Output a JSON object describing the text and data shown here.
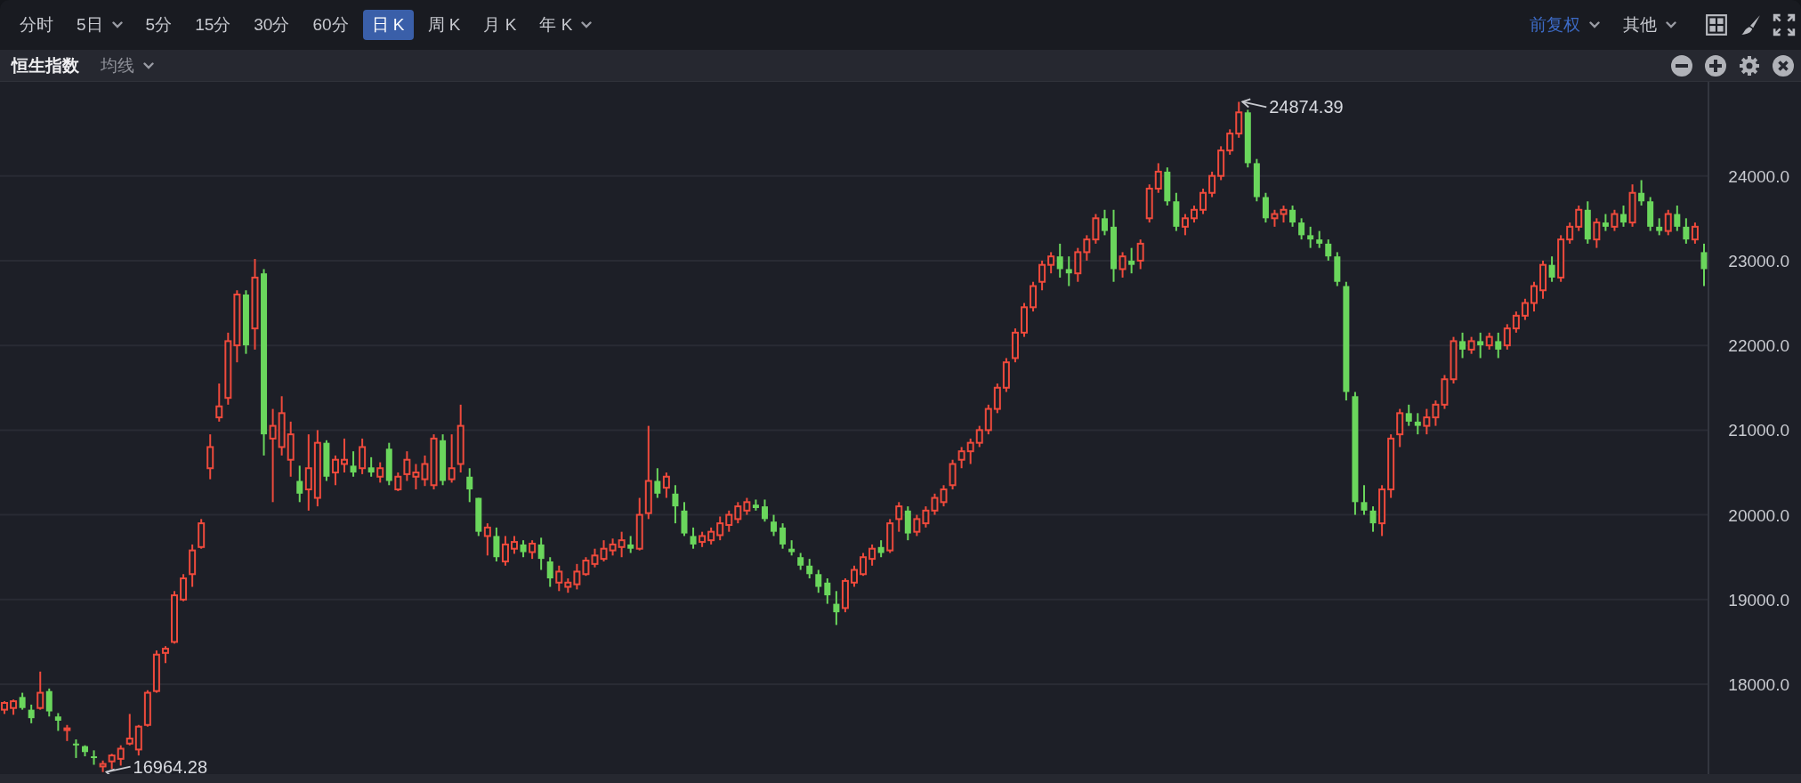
{
  "toolbar": {
    "periods": [
      {
        "label": "分时",
        "selected": false,
        "menu": false
      },
      {
        "label": "5日",
        "selected": false,
        "menu": true
      },
      {
        "label": "5分",
        "selected": false,
        "menu": false
      },
      {
        "label": "15分",
        "selected": false,
        "menu": false
      },
      {
        "label": "30分",
        "selected": false,
        "menu": false
      },
      {
        "label": "60分",
        "selected": false,
        "menu": false
      },
      {
        "label": "日 K",
        "selected": true,
        "menu": false
      },
      {
        "label": "周 K",
        "selected": false,
        "menu": false
      },
      {
        "label": "月 K",
        "selected": false,
        "menu": false
      },
      {
        "label": "年 K",
        "selected": false,
        "menu": true
      }
    ],
    "options": [
      {
        "label": "前复权",
        "selected": true,
        "menu": true
      },
      {
        "label": "其他",
        "selected": false,
        "menu": true
      }
    ]
  },
  "panel": {
    "title": "恒生指数",
    "indicator": {
      "label": "均线",
      "menu": true
    }
  },
  "chart": {
    "chart_data": {
      "type": "candlestick",
      "grid": true,
      "ylim": [
        16940,
        25110
      ],
      "yticks": [
        {
          "value": 24000,
          "label": "24000.0"
        },
        {
          "value": 23000,
          "label": "23000.0"
        },
        {
          "value": 22000,
          "label": "22000.0"
        },
        {
          "value": 21000,
          "label": "21000.0"
        },
        {
          "value": 20000,
          "label": "20000.0"
        },
        {
          "value": 19000,
          "label": "19000.0"
        },
        {
          "value": 18000,
          "label": "18000.0"
        }
      ],
      "ohlc": [
        [
          17700,
          17800,
          17650,
          17780
        ],
        [
          17720,
          17820,
          17640,
          17800
        ],
        [
          17850,
          17900,
          17700,
          17720
        ],
        [
          17700,
          17760,
          17540,
          17600
        ],
        [
          17720,
          18150,
          17700,
          17900
        ],
        [
          17920,
          17950,
          17620,
          17680
        ],
        [
          17620,
          17660,
          17450,
          17570
        ],
        [
          17470,
          17520,
          17330,
          17480
        ],
        [
          17300,
          17350,
          17130,
          17280
        ],
        [
          17270,
          17280,
          17150,
          17200
        ],
        [
          17150,
          17220,
          17050,
          17130
        ],
        [
          17030,
          17100,
          16964,
          17060
        ],
        [
          17090,
          17180,
          17000,
          17160
        ],
        [
          17120,
          17280,
          17040,
          17240
        ],
        [
          17300,
          17650,
          17280,
          17360
        ],
        [
          17230,
          17520,
          17160,
          17500
        ],
        [
          17520,
          17930,
          17500,
          17900
        ],
        [
          17920,
          18400,
          17900,
          18350
        ],
        [
          18370,
          18450,
          18250,
          18420
        ],
        [
          18500,
          19100,
          18480,
          19050
        ],
        [
          19000,
          19300,
          18980,
          19250
        ],
        [
          19300,
          19650,
          19150,
          19580
        ],
        [
          19620,
          19950,
          19600,
          19900
        ],
        [
          20550,
          20950,
          20420,
          20800
        ],
        [
          21150,
          21550,
          21100,
          21280
        ],
        [
          21380,
          22150,
          21300,
          22050
        ],
        [
          22000,
          22650,
          21800,
          22600
        ],
        [
          22600,
          22650,
          21900,
          22000
        ],
        [
          22200,
          23020,
          21950,
          22800
        ],
        [
          22850,
          22900,
          20700,
          20950
        ],
        [
          20900,
          21250,
          20150,
          21050
        ],
        [
          20800,
          21400,
          20700,
          21200
        ],
        [
          20650,
          21100,
          20450,
          20950
        ],
        [
          20400,
          20580,
          20150,
          20250
        ],
        [
          20300,
          20950,
          20050,
          20550
        ],
        [
          20200,
          21000,
          20100,
          20850
        ],
        [
          20850,
          20880,
          20400,
          20450
        ],
        [
          20500,
          20700,
          20350,
          20650
        ],
        [
          20600,
          20900,
          20500,
          20650
        ],
        [
          20580,
          20750,
          20450,
          20500
        ],
        [
          20550,
          20900,
          20480,
          20800
        ],
        [
          20560,
          20680,
          20450,
          20500
        ],
        [
          20450,
          20620,
          20380,
          20550
        ],
        [
          20780,
          20850,
          20350,
          20400
        ],
        [
          20300,
          20500,
          20280,
          20450
        ],
        [
          20480,
          20750,
          20400,
          20650
        ],
        [
          20450,
          20600,
          20300,
          20500
        ],
        [
          20420,
          20700,
          20340,
          20600
        ],
        [
          20350,
          20950,
          20300,
          20900
        ],
        [
          20880,
          20950,
          20350,
          20400
        ],
        [
          20420,
          20950,
          20380,
          20550
        ],
        [
          20600,
          21300,
          20500,
          21050
        ],
        [
          20450,
          20550,
          20150,
          20300
        ],
        [
          20200,
          20200,
          19750,
          19800
        ],
        [
          19750,
          19900,
          19520,
          19850
        ],
        [
          19750,
          19850,
          19450,
          19500
        ],
        [
          19450,
          19750,
          19400,
          19650
        ],
        [
          19600,
          19750,
          19540,
          19680
        ],
        [
          19650,
          19700,
          19500,
          19560
        ],
        [
          19560,
          19700,
          19480,
          19660
        ],
        [
          19650,
          19730,
          19350,
          19480
        ],
        [
          19450,
          19500,
          19150,
          19250
        ],
        [
          19200,
          19400,
          19100,
          19330
        ],
        [
          19150,
          19250,
          19080,
          19200
        ],
        [
          19180,
          19420,
          19120,
          19330
        ],
        [
          19300,
          19500,
          19280,
          19460
        ],
        [
          19420,
          19600,
          19380,
          19520
        ],
        [
          19480,
          19700,
          19450,
          19600
        ],
        [
          19580,
          19720,
          19520,
          19650
        ],
        [
          19620,
          19800,
          19500,
          19700
        ],
        [
          19650,
          19750,
          19550,
          19600
        ],
        [
          19600,
          20200,
          19580,
          20000
        ],
        [
          20020,
          21050,
          19950,
          20400
        ],
        [
          20400,
          20550,
          20200,
          20250
        ],
        [
          20320,
          20500,
          20200,
          20450
        ],
        [
          20250,
          20350,
          19900,
          20100
        ],
        [
          20050,
          20150,
          19750,
          19780
        ],
        [
          19750,
          19850,
          19600,
          19650
        ],
        [
          19680,
          19800,
          19620,
          19750
        ],
        [
          19700,
          19850,
          19650,
          19800
        ],
        [
          19760,
          19980,
          19700,
          19900
        ],
        [
          19880,
          20050,
          19800,
          20000
        ],
        [
          19950,
          20150,
          19900,
          20100
        ],
        [
          20050,
          20200,
          20000,
          20150
        ],
        [
          20120,
          20180,
          20050,
          20080
        ],
        [
          20100,
          20180,
          19920,
          19950
        ],
        [
          19920,
          20000,
          19750,
          19800
        ],
        [
          19850,
          19900,
          19600,
          19650
        ],
        [
          19600,
          19700,
          19520,
          19560
        ],
        [
          19500,
          19550,
          19350,
          19400
        ],
        [
          19400,
          19480,
          19250,
          19300
        ],
        [
          19300,
          19350,
          19080,
          19150
        ],
        [
          19200,
          19250,
          18950,
          19050
        ],
        [
          18950,
          19100,
          18700,
          18850
        ],
        [
          18900,
          19250,
          18850,
          19220
        ],
        [
          19200,
          19400,
          19150,
          19350
        ],
        [
          19300,
          19550,
          19280,
          19500
        ],
        [
          19480,
          19650,
          19400,
          19600
        ],
        [
          19620,
          19700,
          19500,
          19550
        ],
        [
          19580,
          19950,
          19550,
          19900
        ],
        [
          19950,
          20150,
          19800,
          20100
        ],
        [
          20050,
          20100,
          19700,
          19780
        ],
        [
          19800,
          20000,
          19750,
          19950
        ],
        [
          19900,
          20100,
          19850,
          20050
        ],
        [
          20050,
          20250,
          20000,
          20200
        ],
        [
          20150,
          20350,
          20100,
          20300
        ],
        [
          20350,
          20650,
          20300,
          20600
        ],
        [
          20650,
          20800,
          20550,
          20750
        ],
        [
          20750,
          20900,
          20600,
          20850
        ],
        [
          20850,
          21050,
          20800,
          21000
        ],
        [
          21000,
          21300,
          20950,
          21250
        ],
        [
          21250,
          21550,
          21200,
          21500
        ],
        [
          21500,
          21850,
          21450,
          21800
        ],
        [
          21850,
          22200,
          21800,
          22150
        ],
        [
          22150,
          22500,
          22100,
          22450
        ],
        [
          22450,
          22750,
          22400,
          22700
        ],
        [
          22750,
          23000,
          22650,
          22950
        ],
        [
          22950,
          23100,
          22850,
          23050
        ],
        [
          23050,
          23200,
          22800,
          22900
        ],
        [
          22900,
          23050,
          22700,
          22850
        ],
        [
          22850,
          23150,
          22750,
          23100
        ],
        [
          23100,
          23300,
          23000,
          23250
        ],
        [
          23250,
          23550,
          23200,
          23500
        ],
        [
          23500,
          23600,
          23300,
          23350
        ],
        [
          23400,
          23600,
          22750,
          22900
        ],
        [
          22900,
          23100,
          22800,
          23050
        ],
        [
          23000,
          23150,
          22850,
          22950
        ],
        [
          23000,
          23250,
          22900,
          23200
        ],
        [
          23500,
          23900,
          23450,
          23850
        ],
        [
          23850,
          24150,
          23800,
          24050
        ],
        [
          24050,
          24100,
          23650,
          23700
        ],
        [
          23700,
          23800,
          23350,
          23400
        ],
        [
          23400,
          23550,
          23300,
          23500
        ],
        [
          23500,
          23650,
          23450,
          23600
        ],
        [
          23600,
          23850,
          23550,
          23800
        ],
        [
          23800,
          24050,
          23750,
          24000
        ],
        [
          24000,
          24350,
          23950,
          24300
        ],
        [
          24300,
          24550,
          24250,
          24500
        ],
        [
          24500,
          24874,
          24450,
          24750
        ],
        [
          24750,
          24780,
          24100,
          24150
        ],
        [
          24150,
          24200,
          23700,
          23750
        ],
        [
          23750,
          23800,
          23450,
          23500
        ],
        [
          23500,
          23600,
          23400,
          23550
        ],
        [
          23550,
          23650,
          23450,
          23600
        ],
        [
          23600,
          23650,
          23400,
          23450
        ],
        [
          23450,
          23500,
          23250,
          23300
        ],
        [
          23300,
          23400,
          23150,
          23250
        ],
        [
          23250,
          23350,
          23150,
          23200
        ],
        [
          23200,
          23250,
          23000,
          23050
        ],
        [
          23050,
          23100,
          22700,
          22750
        ],
        [
          22700,
          22750,
          21350,
          21450
        ],
        [
          21400,
          21450,
          20000,
          20150
        ],
        [
          20150,
          20350,
          20000,
          20050
        ],
        [
          20050,
          20100,
          19800,
          19900
        ],
        [
          19900,
          20350,
          19750,
          20300
        ],
        [
          20300,
          20950,
          20200,
          20900
        ],
        [
          20950,
          21250,
          20800,
          21200
        ],
        [
          21200,
          21300,
          21050,
          21100
        ],
        [
          21100,
          21200,
          20950,
          21050
        ],
        [
          21050,
          21250,
          20950,
          21150
        ],
        [
          21150,
          21350,
          21050,
          21300
        ],
        [
          21300,
          21650,
          21250,
          21600
        ],
        [
          21600,
          22100,
          21550,
          22050
        ],
        [
          22050,
          22150,
          21850,
          21950
        ],
        [
          21950,
          22100,
          21900,
          22050
        ],
        [
          22050,
          22150,
          21850,
          22000
        ],
        [
          22000,
          22150,
          21950,
          22100
        ],
        [
          22050,
          22150,
          21850,
          21950
        ],
        [
          22000,
          22250,
          21950,
          22200
        ],
        [
          22200,
          22400,
          22150,
          22350
        ],
        [
          22350,
          22550,
          22300,
          22500
        ],
        [
          22500,
          22750,
          22400,
          22700
        ],
        [
          22650,
          23000,
          22550,
          22950
        ],
        [
          22950,
          23050,
          22750,
          22800
        ],
        [
          22800,
          23300,
          22750,
          23250
        ],
        [
          23250,
          23450,
          23200,
          23400
        ],
        [
          23400,
          23650,
          23350,
          23600
        ],
        [
          23600,
          23700,
          23200,
          23250
        ],
        [
          23250,
          23500,
          23150,
          23450
        ],
        [
          23450,
          23550,
          23350,
          23400
        ],
        [
          23400,
          23600,
          23350,
          23550
        ],
        [
          23550,
          23650,
          23400,
          23450
        ],
        [
          23450,
          23900,
          23400,
          23800
        ],
        [
          23800,
          23950,
          23650,
          23700
        ],
        [
          23700,
          23750,
          23350,
          23400
        ],
        [
          23400,
          23500,
          23300,
          23350
        ],
        [
          23350,
          23600,
          23300,
          23550
        ],
        [
          23550,
          23650,
          23350,
          23400
        ],
        [
          23400,
          23500,
          23200,
          23250
        ],
        [
          23250,
          23450,
          23200,
          23400
        ],
        [
          23100,
          23200,
          22700,
          22900
        ]
      ]
    },
    "annotations": [
      {
        "text": "24874.39",
        "kind": "high"
      },
      {
        "text": "16964.28",
        "kind": "low"
      }
    ]
  }
}
